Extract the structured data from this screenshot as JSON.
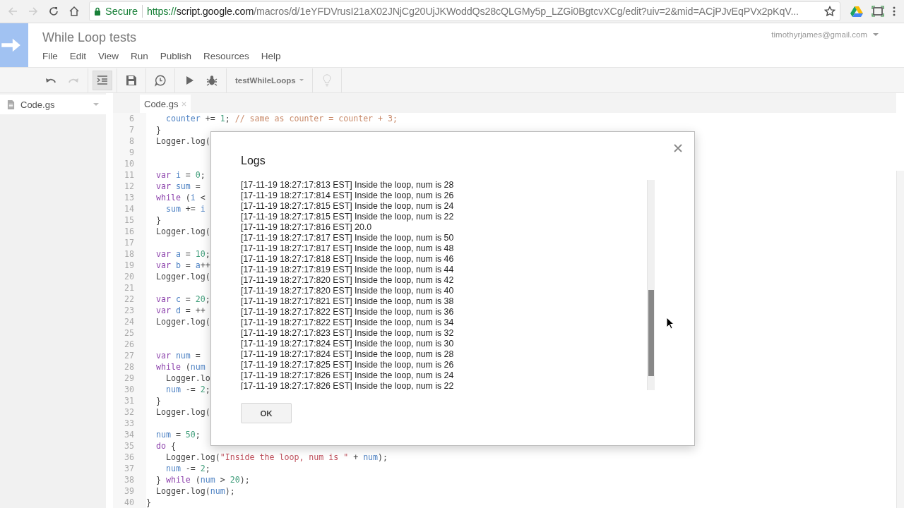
{
  "browser": {
    "secure_label": "Secure",
    "url": {
      "scheme": "https://",
      "host": "script.google.com",
      "path": "/macros/d/1eYFDVrusI21aX02JNjCg20UjJKWoddQs28cQLGMy5p_LZGi0BgtcvXCg/edit?uiv=2&mid=ACjPJvEqPVx2pKqV..."
    }
  },
  "app": {
    "title": "While Loop tests",
    "menu": [
      "File",
      "Edit",
      "View",
      "Run",
      "Publish",
      "Resources",
      "Help"
    ],
    "account": "timothyrjames@gmail.com"
  },
  "toolbar": {
    "buttons": [
      {
        "kind": "undo",
        "disabled": false,
        "pressed": false
      },
      {
        "kind": "redo",
        "disabled": true,
        "pressed": false
      },
      {
        "kind": "indent",
        "disabled": false,
        "pressed": true
      },
      {
        "kind": "save",
        "disabled": false,
        "pressed": false
      },
      {
        "kind": "triggers",
        "disabled": false,
        "pressed": false
      },
      {
        "kind": "run",
        "disabled": false,
        "pressed": false
      },
      {
        "kind": "debug",
        "disabled": false,
        "pressed": false
      }
    ],
    "function_name": "testWhileLoops",
    "hint_disabled": true
  },
  "sidebar": {
    "files": [
      {
        "name": "Code.gs"
      }
    ]
  },
  "editor": {
    "tab": "Code.gs",
    "lines": [
      {
        "number": "6",
        "tokens": [
          {
            "kind": "variable",
            "text": "    counter"
          },
          {
            "kind": "plain",
            "text": " += "
          },
          {
            "kind": "number",
            "text": "1"
          },
          {
            "kind": "plain",
            "text": "; "
          },
          {
            "kind": "comment",
            "text": "// same as counter = counter + 3;"
          }
        ]
      },
      {
        "number": "7",
        "tokens": [
          {
            "kind": "plain",
            "text": "  }"
          }
        ]
      },
      {
        "number": "8",
        "tokens": [
          {
            "kind": "plain",
            "text": "  Logger.log("
          }
        ]
      },
      {
        "number": "9"
      },
      {
        "number": "10"
      },
      {
        "number": "11",
        "tokens": [
          {
            "kind": "keyword",
            "text": "  var"
          },
          {
            "kind": "variable",
            "text": " i"
          },
          {
            "kind": "plain",
            "text": " = "
          },
          {
            "kind": "number",
            "text": "0"
          },
          {
            "kind": "plain",
            "text": ";"
          }
        ]
      },
      {
        "number": "12",
        "tokens": [
          {
            "kind": "keyword",
            "text": "  var"
          },
          {
            "kind": "variable",
            "text": " sum"
          },
          {
            "kind": "plain",
            "text": " ="
          }
        ]
      },
      {
        "number": "13",
        "tokens": [
          {
            "kind": "keyword",
            "text": "  while"
          },
          {
            "kind": "plain",
            "text": " ("
          },
          {
            "kind": "variable",
            "text": "i"
          },
          {
            "kind": "plain",
            "text": " <"
          }
        ]
      },
      {
        "number": "14",
        "tokens": [
          {
            "kind": "variable",
            "text": "    sum"
          },
          {
            "kind": "plain",
            "text": " += "
          },
          {
            "kind": "variable",
            "text": "i"
          }
        ]
      },
      {
        "number": "15",
        "tokens": [
          {
            "kind": "plain",
            "text": "  }"
          }
        ]
      },
      {
        "number": "16",
        "tokens": [
          {
            "kind": "plain",
            "text": "  Logger.log("
          }
        ]
      },
      {
        "number": "17"
      },
      {
        "number": "18",
        "tokens": [
          {
            "kind": "keyword",
            "text": "  var"
          },
          {
            "kind": "variable",
            "text": " a"
          },
          {
            "kind": "plain",
            "text": " = "
          },
          {
            "kind": "number",
            "text": "10"
          },
          {
            "kind": "plain",
            "text": ";"
          }
        ]
      },
      {
        "number": "19",
        "tokens": [
          {
            "kind": "keyword",
            "text": "  var"
          },
          {
            "kind": "variable",
            "text": " b"
          },
          {
            "kind": "plain",
            "text": " = "
          },
          {
            "kind": "variable",
            "text": "a"
          },
          {
            "kind": "plain",
            "text": "++"
          }
        ]
      },
      {
        "number": "20",
        "tokens": [
          {
            "kind": "plain",
            "text": "  Logger.log("
          }
        ]
      },
      {
        "number": "21"
      },
      {
        "number": "22",
        "tokens": [
          {
            "kind": "keyword",
            "text": "  var"
          },
          {
            "kind": "variable",
            "text": " c"
          },
          {
            "kind": "plain",
            "text": " = "
          },
          {
            "kind": "number",
            "text": "20"
          },
          {
            "kind": "plain",
            "text": ";"
          }
        ]
      },
      {
        "number": "23",
        "tokens": [
          {
            "kind": "keyword",
            "text": "  var"
          },
          {
            "kind": "variable",
            "text": " d"
          },
          {
            "kind": "plain",
            "text": " = ++"
          }
        ]
      },
      {
        "number": "24",
        "tokens": [
          {
            "kind": "plain",
            "text": "  Logger.log("
          }
        ]
      },
      {
        "number": "25"
      },
      {
        "number": "26"
      },
      {
        "number": "27",
        "tokens": [
          {
            "kind": "keyword",
            "text": "  var"
          },
          {
            "kind": "variable",
            "text": " num"
          },
          {
            "kind": "plain",
            "text": " ="
          }
        ]
      },
      {
        "number": "28",
        "tokens": [
          {
            "kind": "keyword",
            "text": "  while"
          },
          {
            "kind": "plain",
            "text": " ("
          },
          {
            "kind": "variable",
            "text": "num"
          }
        ]
      },
      {
        "number": "29",
        "tokens": [
          {
            "kind": "plain",
            "text": "    Logger.lo"
          }
        ]
      },
      {
        "number": "30",
        "tokens": [
          {
            "kind": "variable",
            "text": "    num"
          },
          {
            "kind": "plain",
            "text": " -= "
          },
          {
            "kind": "number",
            "text": "2"
          },
          {
            "kind": "plain",
            "text": ";"
          }
        ]
      },
      {
        "number": "31",
        "tokens": [
          {
            "kind": "plain",
            "text": "  }"
          }
        ]
      },
      {
        "number": "32",
        "tokens": [
          {
            "kind": "plain",
            "text": "  Logger.log("
          }
        ]
      },
      {
        "number": "33"
      },
      {
        "number": "34",
        "tokens": [
          {
            "kind": "variable",
            "text": "  num"
          },
          {
            "kind": "plain",
            "text": " = "
          },
          {
            "kind": "number",
            "text": "50"
          },
          {
            "kind": "plain",
            "text": ";"
          }
        ]
      },
      {
        "number": "35",
        "tokens": [
          {
            "kind": "keyword",
            "text": "  do"
          },
          {
            "kind": "plain",
            "text": " {"
          }
        ]
      },
      {
        "number": "36",
        "tokens": [
          {
            "kind": "plain",
            "text": "    Logger.log("
          },
          {
            "kind": "string",
            "text": "\"Inside the loop, num is \""
          },
          {
            "kind": "plain",
            "text": " + "
          },
          {
            "kind": "variable",
            "text": "num"
          },
          {
            "kind": "plain",
            "text": ");"
          }
        ]
      },
      {
        "number": "37",
        "tokens": [
          {
            "kind": "variable",
            "text": "    num"
          },
          {
            "kind": "plain",
            "text": " -= "
          },
          {
            "kind": "number",
            "text": "2"
          },
          {
            "kind": "plain",
            "text": ";"
          }
        ]
      },
      {
        "number": "38",
        "tokens": [
          {
            "kind": "plain",
            "text": "  } "
          },
          {
            "kind": "keyword",
            "text": "while"
          },
          {
            "kind": "plain",
            "text": " ("
          },
          {
            "kind": "variable",
            "text": "num"
          },
          {
            "kind": "plain",
            "text": " > "
          },
          {
            "kind": "number",
            "text": "20"
          },
          {
            "kind": "plain",
            "text": ");"
          }
        ]
      },
      {
        "number": "39",
        "tokens": [
          {
            "kind": "plain",
            "text": "  Logger.log("
          },
          {
            "kind": "variable",
            "text": "num"
          },
          {
            "kind": "plain",
            "text": ");"
          }
        ]
      },
      {
        "number": "40",
        "tokens": [
          {
            "kind": "plain",
            "text": "}"
          }
        ]
      }
    ]
  },
  "dialog": {
    "title": "Logs",
    "ok": "OK",
    "entries": [
      "[17-11-19 18:27:17:813 EST] Inside the loop, num is 28",
      "[17-11-19 18:27:17:814 EST] Inside the loop, num is 26",
      "[17-11-19 18:27:17:815 EST] Inside the loop, num is 24",
      "[17-11-19 18:27:17:815 EST] Inside the loop, num is 22",
      "[17-11-19 18:27:17:816 EST] 20.0",
      "[17-11-19 18:27:17:817 EST] Inside the loop, num is 50",
      "[17-11-19 18:27:17:817 EST] Inside the loop, num is 48",
      "[17-11-19 18:27:17:818 EST] Inside the loop, num is 46",
      "[17-11-19 18:27:17:819 EST] Inside the loop, num is 44",
      "[17-11-19 18:27:17:820 EST] Inside the loop, num is 42",
      "[17-11-19 18:27:17:820 EST] Inside the loop, num is 40",
      "[17-11-19 18:27:17:821 EST] Inside the loop, num is 38",
      "[17-11-19 18:27:17:822 EST] Inside the loop, num is 36",
      "[17-11-19 18:27:17:822 EST] Inside the loop, num is 34",
      "[17-11-19 18:27:17:823 EST] Inside the loop, num is 32",
      "[17-11-19 18:27:17:824 EST] Inside the loop, num is 30",
      "[17-11-19 18:27:17:824 EST] Inside the loop, num is 28",
      "[17-11-19 18:27:17:825 EST] Inside the loop, num is 26",
      "[17-11-19 18:27:17:826 EST] Inside the loop, num is 24",
      "[17-11-19 18:27:17:826 EST] Inside the loop, num is 22"
    ]
  }
}
